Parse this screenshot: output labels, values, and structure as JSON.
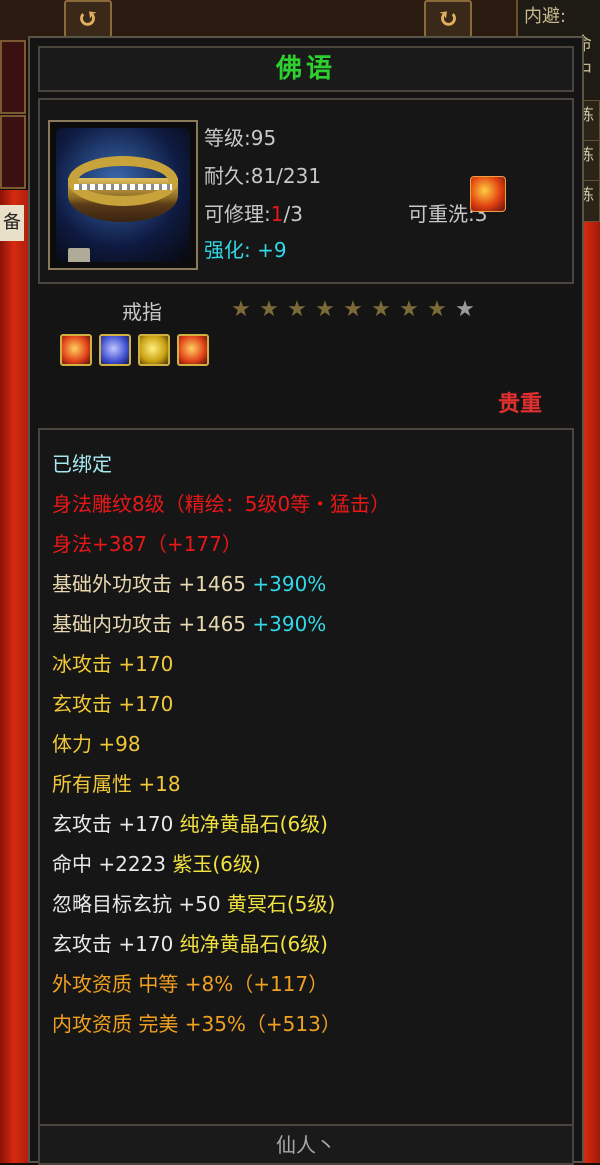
{
  "background": {
    "left_buttons": [
      "↺",
      "↻"
    ],
    "right_panel_text": [
      "内避:",
      "命中",
      "生",
      "练",
      "练",
      "练"
    ],
    "right_tabs": [
      "练",
      "练",
      "练"
    ],
    "left_label": "备"
  },
  "item": {
    "name": "佛语",
    "level": "等级:95",
    "durability": "耐久:81/231",
    "repair_prefix": "可修理:",
    "repair_current": "1",
    "repair_max": "/3",
    "rewash": "可重洗:3",
    "enhance_label": "强化:",
    "enhance_value": "+9",
    "type": "戒指",
    "stars_total": 9,
    "stars_lit": 8,
    "rarity": "贵重",
    "socket_gems": [
      "red-gem",
      "blue-gem",
      "yellow-gem",
      "red-gem"
    ]
  },
  "attributes": [
    {
      "parts": [
        {
          "text": "已绑定",
          "color": "#a8e8f0"
        }
      ]
    },
    {
      "parts": [
        {
          "text": "身法雕纹8级（精绘：5级0等・猛击）",
          "color": "#e81818"
        }
      ]
    },
    {
      "parts": [
        {
          "text": "身法+387（+177）",
          "color": "#e81818"
        }
      ]
    },
    {
      "parts": [
        {
          "text": "基础外功攻击 +1465 ",
          "color": "#e8d8b0"
        },
        {
          "text": "+390%",
          "color": "#30d8e8"
        }
      ]
    },
    {
      "parts": [
        {
          "text": "基础内功攻击 +1465 ",
          "color": "#e8d8b0"
        },
        {
          "text": "+390%",
          "color": "#30d8e8"
        }
      ]
    },
    {
      "parts": [
        {
          "text": "冰攻击 +170",
          "color": "#f0c838"
        }
      ]
    },
    {
      "parts": [
        {
          "text": "玄攻击 +170",
          "color": "#f0c838"
        }
      ]
    },
    {
      "parts": [
        {
          "text": "体力 +98",
          "color": "#f0c838"
        }
      ]
    },
    {
      "parts": [
        {
          "text": "所有属性 +18",
          "color": "#f0c838"
        }
      ]
    },
    {
      "parts": [
        {
          "text": "玄攻击 +170 ",
          "color": "#e8e8e8"
        },
        {
          "text": "纯净黄晶石(6级)",
          "color": "#f0e040"
        }
      ]
    },
    {
      "parts": [
        {
          "text": "命中 +2223 ",
          "color": "#e8e8e8"
        },
        {
          "text": "紫玉(6级)",
          "color": "#f0e040"
        }
      ]
    },
    {
      "parts": [
        {
          "text": "忽略目标玄抗 +50 ",
          "color": "#e8e8e8"
        },
        {
          "text": "黄冥石(5级)",
          "color": "#f0e040"
        }
      ]
    },
    {
      "parts": [
        {
          "text": "玄攻击 +170 ",
          "color": "#e8e8e8"
        },
        {
          "text": "纯净黄晶石(6级)",
          "color": "#f0e040"
        }
      ]
    },
    {
      "parts": [
        {
          "text": "外攻资质   中等 +8%（+117）",
          "color": "#f0a020"
        }
      ]
    },
    {
      "parts": [
        {
          "text": "内攻资质   完美 +35%（+513）",
          "color": "#f0a020"
        }
      ]
    }
  ],
  "footer": "仙人丶",
  "colors": {
    "title": "#2ed02e",
    "enhance": "#30d8e8",
    "rarity": "#e03030",
    "repair_current": "#e81818"
  }
}
